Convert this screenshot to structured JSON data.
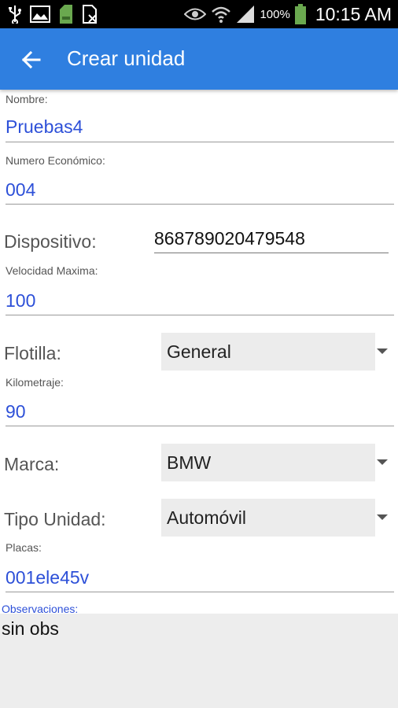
{
  "status_bar": {
    "battery_text": "100%",
    "time": "10:15 AM",
    "icons": [
      "usb-icon",
      "image-icon",
      "sd-card-icon",
      "document-icon",
      "eye-icon",
      "wifi-icon",
      "signal-icon",
      "battery-icon"
    ]
  },
  "app_bar": {
    "back_icon": "arrow-left-icon",
    "title": "Crear unidad",
    "color": "#2f7fe0"
  },
  "form": {
    "nombre": {
      "label": "Nombre:",
      "value": "Pruebas4"
    },
    "numero_economico": {
      "label": "Numero Económico:",
      "value": "004"
    },
    "dispositivo": {
      "label": "Dispositivo:",
      "value": "868789020479548"
    },
    "velocidad_maxima": {
      "label": "Velocidad Maxima:",
      "value": "100"
    },
    "flotilla": {
      "label": "Flotilla:",
      "selected": "General"
    },
    "kilometraje": {
      "label": "Kilometraje:",
      "value": "90"
    },
    "marca": {
      "label": "Marca:",
      "selected": "BMW"
    },
    "tipo_unidad": {
      "label": "Tipo Unidad:",
      "selected": "Automóvil"
    },
    "placas": {
      "label": "Placas:",
      "value": "001ele45v"
    },
    "observaciones": {
      "label": "Observaciones:",
      "value": "sin obs"
    }
  },
  "colors": {
    "accent_text": "#2d50d8",
    "spinner_bg": "#ececec"
  }
}
